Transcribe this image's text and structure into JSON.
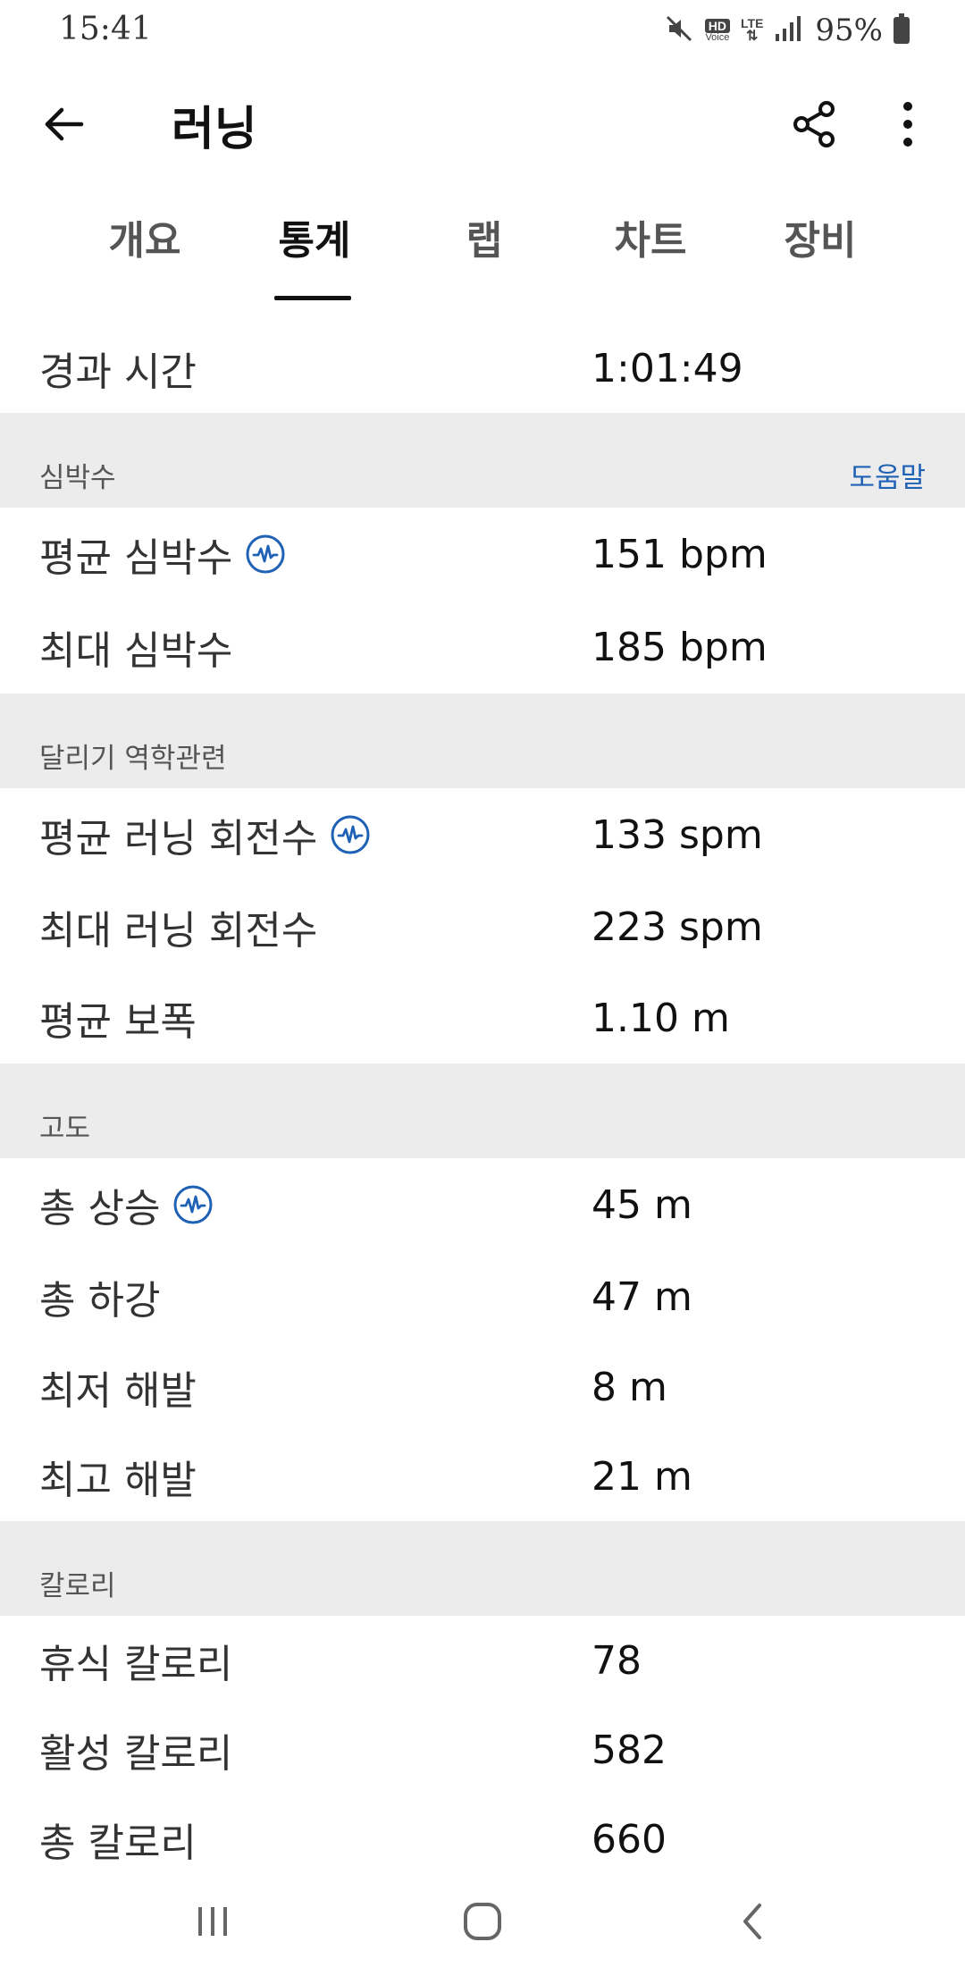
{
  "status_bar": {
    "time": "15:41",
    "hd_label": "HD",
    "voice_label": "Voice",
    "lte_label": "LTE",
    "battery_percent": "95%",
    "icons": [
      "mute-icon",
      "signal-icon",
      "battery-icon"
    ]
  },
  "app_bar": {
    "title": "러닝",
    "back_icon": "arrow-back-icon",
    "share_icon": "share-icon",
    "more_icon": "more-vertical-icon"
  },
  "tabs": [
    {
      "label": "개요",
      "active": false
    },
    {
      "label": "통계",
      "active": true
    },
    {
      "label": "랩",
      "active": false
    },
    {
      "label": "차트",
      "active": false
    },
    {
      "label": "장비",
      "active": false
    }
  ],
  "elapsed": {
    "label": "경과 시간",
    "value": "1:01:49"
  },
  "heart_rate": {
    "title": "심박수",
    "help": "도움말",
    "rows": [
      {
        "label": "평균 심박수",
        "value": "151 bpm",
        "icon": "performance-icon"
      },
      {
        "label": "최대 심박수",
        "value": "185 bpm"
      }
    ]
  },
  "running_dynamics": {
    "title": "달리기 역학관련",
    "rows": [
      {
        "label": "평균 러닝 회전수",
        "value": "133 spm",
        "icon": "performance-icon"
      },
      {
        "label": "최대 러닝 회전수",
        "value": "223 spm"
      },
      {
        "label": "평균 보폭",
        "value": "1.10 m"
      }
    ]
  },
  "elevation": {
    "title": "고도",
    "rows": [
      {
        "label": "총 상승",
        "value": "45 m",
        "icon": "performance-icon"
      },
      {
        "label": "총 하강",
        "value": "47 m"
      },
      {
        "label": "최저 해발",
        "value": "8 m"
      },
      {
        "label": "최고 해발",
        "value": "21 m"
      }
    ]
  },
  "calories": {
    "title": "칼로리",
    "rows": [
      {
        "label": "휴식 칼로리",
        "value": "78"
      },
      {
        "label": "활성 칼로리",
        "value": "582"
      },
      {
        "label": "총 칼로리",
        "value": "660"
      }
    ]
  },
  "nav_bar": {
    "icons": [
      "recent-apps-icon",
      "home-icon",
      "back-icon"
    ]
  },
  "colors": {
    "accent": "#1f62b5",
    "section_bg": "#ececec",
    "text": "#222222"
  }
}
